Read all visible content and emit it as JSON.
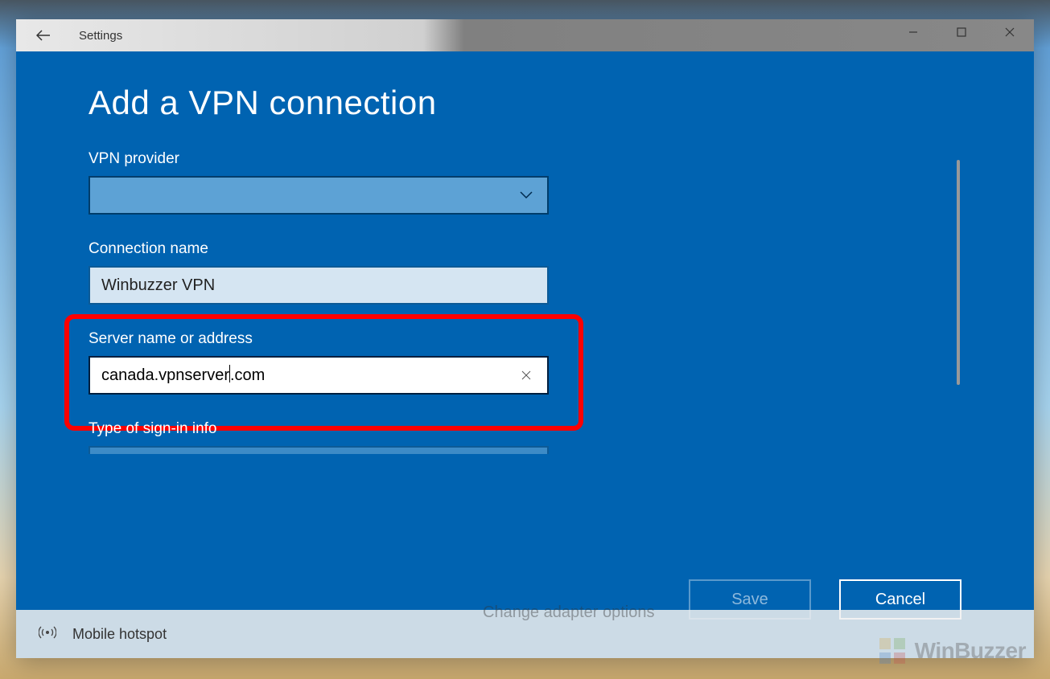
{
  "window": {
    "title": "Settings"
  },
  "modal": {
    "title": "Add a VPN connection",
    "fields": {
      "provider": {
        "label": "VPN provider",
        "value": ""
      },
      "connection_name": {
        "label": "Connection name",
        "value": "Winbuzzer VPN"
      },
      "server": {
        "label": "Server name or address",
        "value_before_cursor": "canada.vpnserver",
        "value_after_cursor": ".com"
      },
      "signin_type": {
        "label": "Type of sign-in info"
      }
    },
    "buttons": {
      "save": "Save",
      "cancel": "Cancel"
    }
  },
  "background": {
    "sidebar_item": "Mobile hotspot",
    "right_link": "Change adapter options"
  },
  "watermark": {
    "text": "WinBuzzer"
  }
}
